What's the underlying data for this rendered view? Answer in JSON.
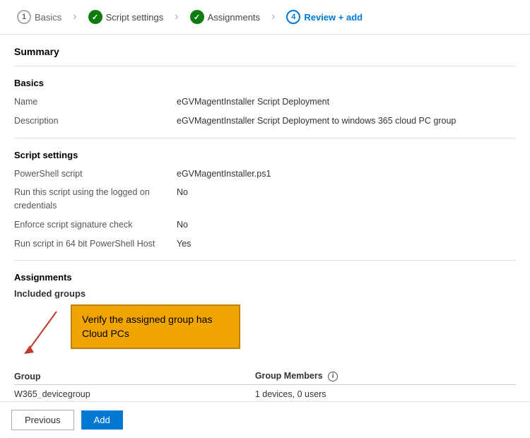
{
  "wizard": {
    "steps": [
      {
        "id": "basics",
        "label": "Basics",
        "state": "number",
        "number": "1"
      },
      {
        "id": "script-settings",
        "label": "Script settings",
        "state": "check"
      },
      {
        "id": "assignments",
        "label": "Assignments",
        "state": "check"
      },
      {
        "id": "review-add",
        "label": "Review + add",
        "state": "active",
        "number": "4"
      }
    ]
  },
  "summary": {
    "title": "Summary",
    "basics": {
      "title": "Basics",
      "name_label": "Name",
      "name_value": "eGVMagentInstaller Script Deployment",
      "description_label": "Description",
      "description_value": "eGVMagentInstaller Script Deployment to windows 365 cloud PC group"
    },
    "script_settings": {
      "title": "Script settings",
      "powershell_label": "PowerShell script",
      "powershell_value": "eGVMagentInstaller.ps1",
      "logged_on_label": "Run this script using the logged on credentials",
      "logged_on_value": "No",
      "signature_label": "Enforce script signature check",
      "signature_value": "No",
      "bit64_label": "Run script in 64 bit PowerShell Host",
      "bit64_value": "Yes"
    },
    "assignments": {
      "title": "Assignments",
      "included_groups_label": "Included groups",
      "tooltip_text": "Verify the assigned group has Cloud PCs",
      "table": {
        "group_header": "Group",
        "group_members_header": "Group Members",
        "rows": [
          {
            "group": "W365_devicegroup",
            "members": "1 devices, 0 users"
          }
        ]
      }
    }
  },
  "footer": {
    "previous_label": "Previous",
    "add_label": "Add"
  }
}
